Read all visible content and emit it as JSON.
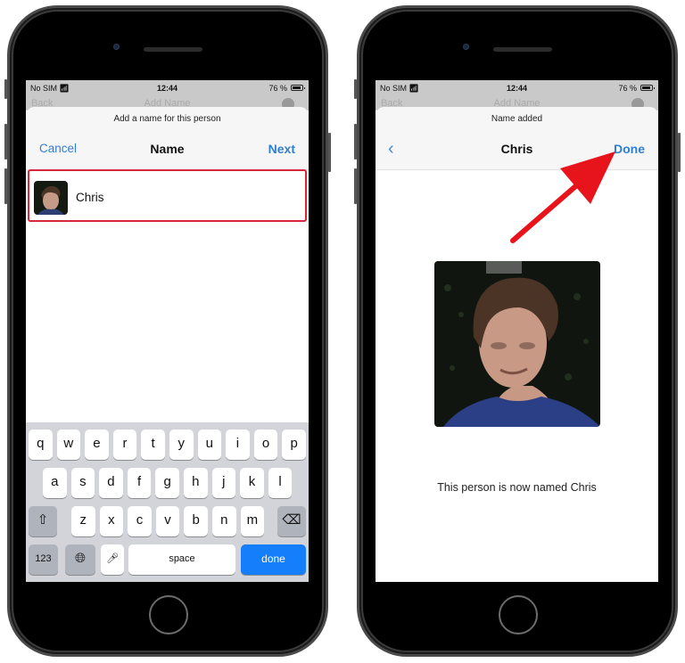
{
  "left_phone": {
    "status_bar": {
      "carrier": "No SIM",
      "wifi_icon": "wifi-icon",
      "time": "12:44",
      "battery": "76 %",
      "battery_icon": "battery-icon"
    },
    "background_nav": {
      "back": "Back",
      "title": "Add Name"
    },
    "sheet": {
      "prompt": "Add a name for this person",
      "cancel_label": "Cancel",
      "title": "Name",
      "next_label": "Next",
      "name_field_value": "Chris",
      "highlight_color": "#d6283a"
    },
    "keyboard": {
      "row1": [
        "q",
        "w",
        "e",
        "r",
        "t",
        "y",
        "u",
        "i",
        "o",
        "p"
      ],
      "row2": [
        "a",
        "s",
        "d",
        "f",
        "g",
        "h",
        "j",
        "k",
        "l"
      ],
      "row3": [
        "z",
        "x",
        "c",
        "v",
        "b",
        "n",
        "m"
      ],
      "shift_icon": "shift-icon",
      "delete_icon": "delete-icon",
      "numbers_label": "123",
      "globe_icon": "globe-icon",
      "mic_icon": "microphone-icon",
      "space_label": "space",
      "done_label": "done",
      "done_color": "#147efb"
    }
  },
  "right_phone": {
    "status_bar": {
      "carrier": "No SIM",
      "wifi_icon": "wifi-icon",
      "time": "12:44",
      "battery": "76 %",
      "battery_icon": "battery-icon"
    },
    "background_nav": {
      "back": "Back",
      "title": "Add Name"
    },
    "sheet": {
      "prompt": "Name added",
      "back_icon": "chevron-left-icon",
      "title": "Chris",
      "done_label": "Done",
      "confirmation": "This person is now named Chris"
    },
    "annotation": {
      "type": "arrow",
      "color": "#e8141c",
      "points_to": "Done"
    }
  },
  "accent_color": "#2f7fd0"
}
